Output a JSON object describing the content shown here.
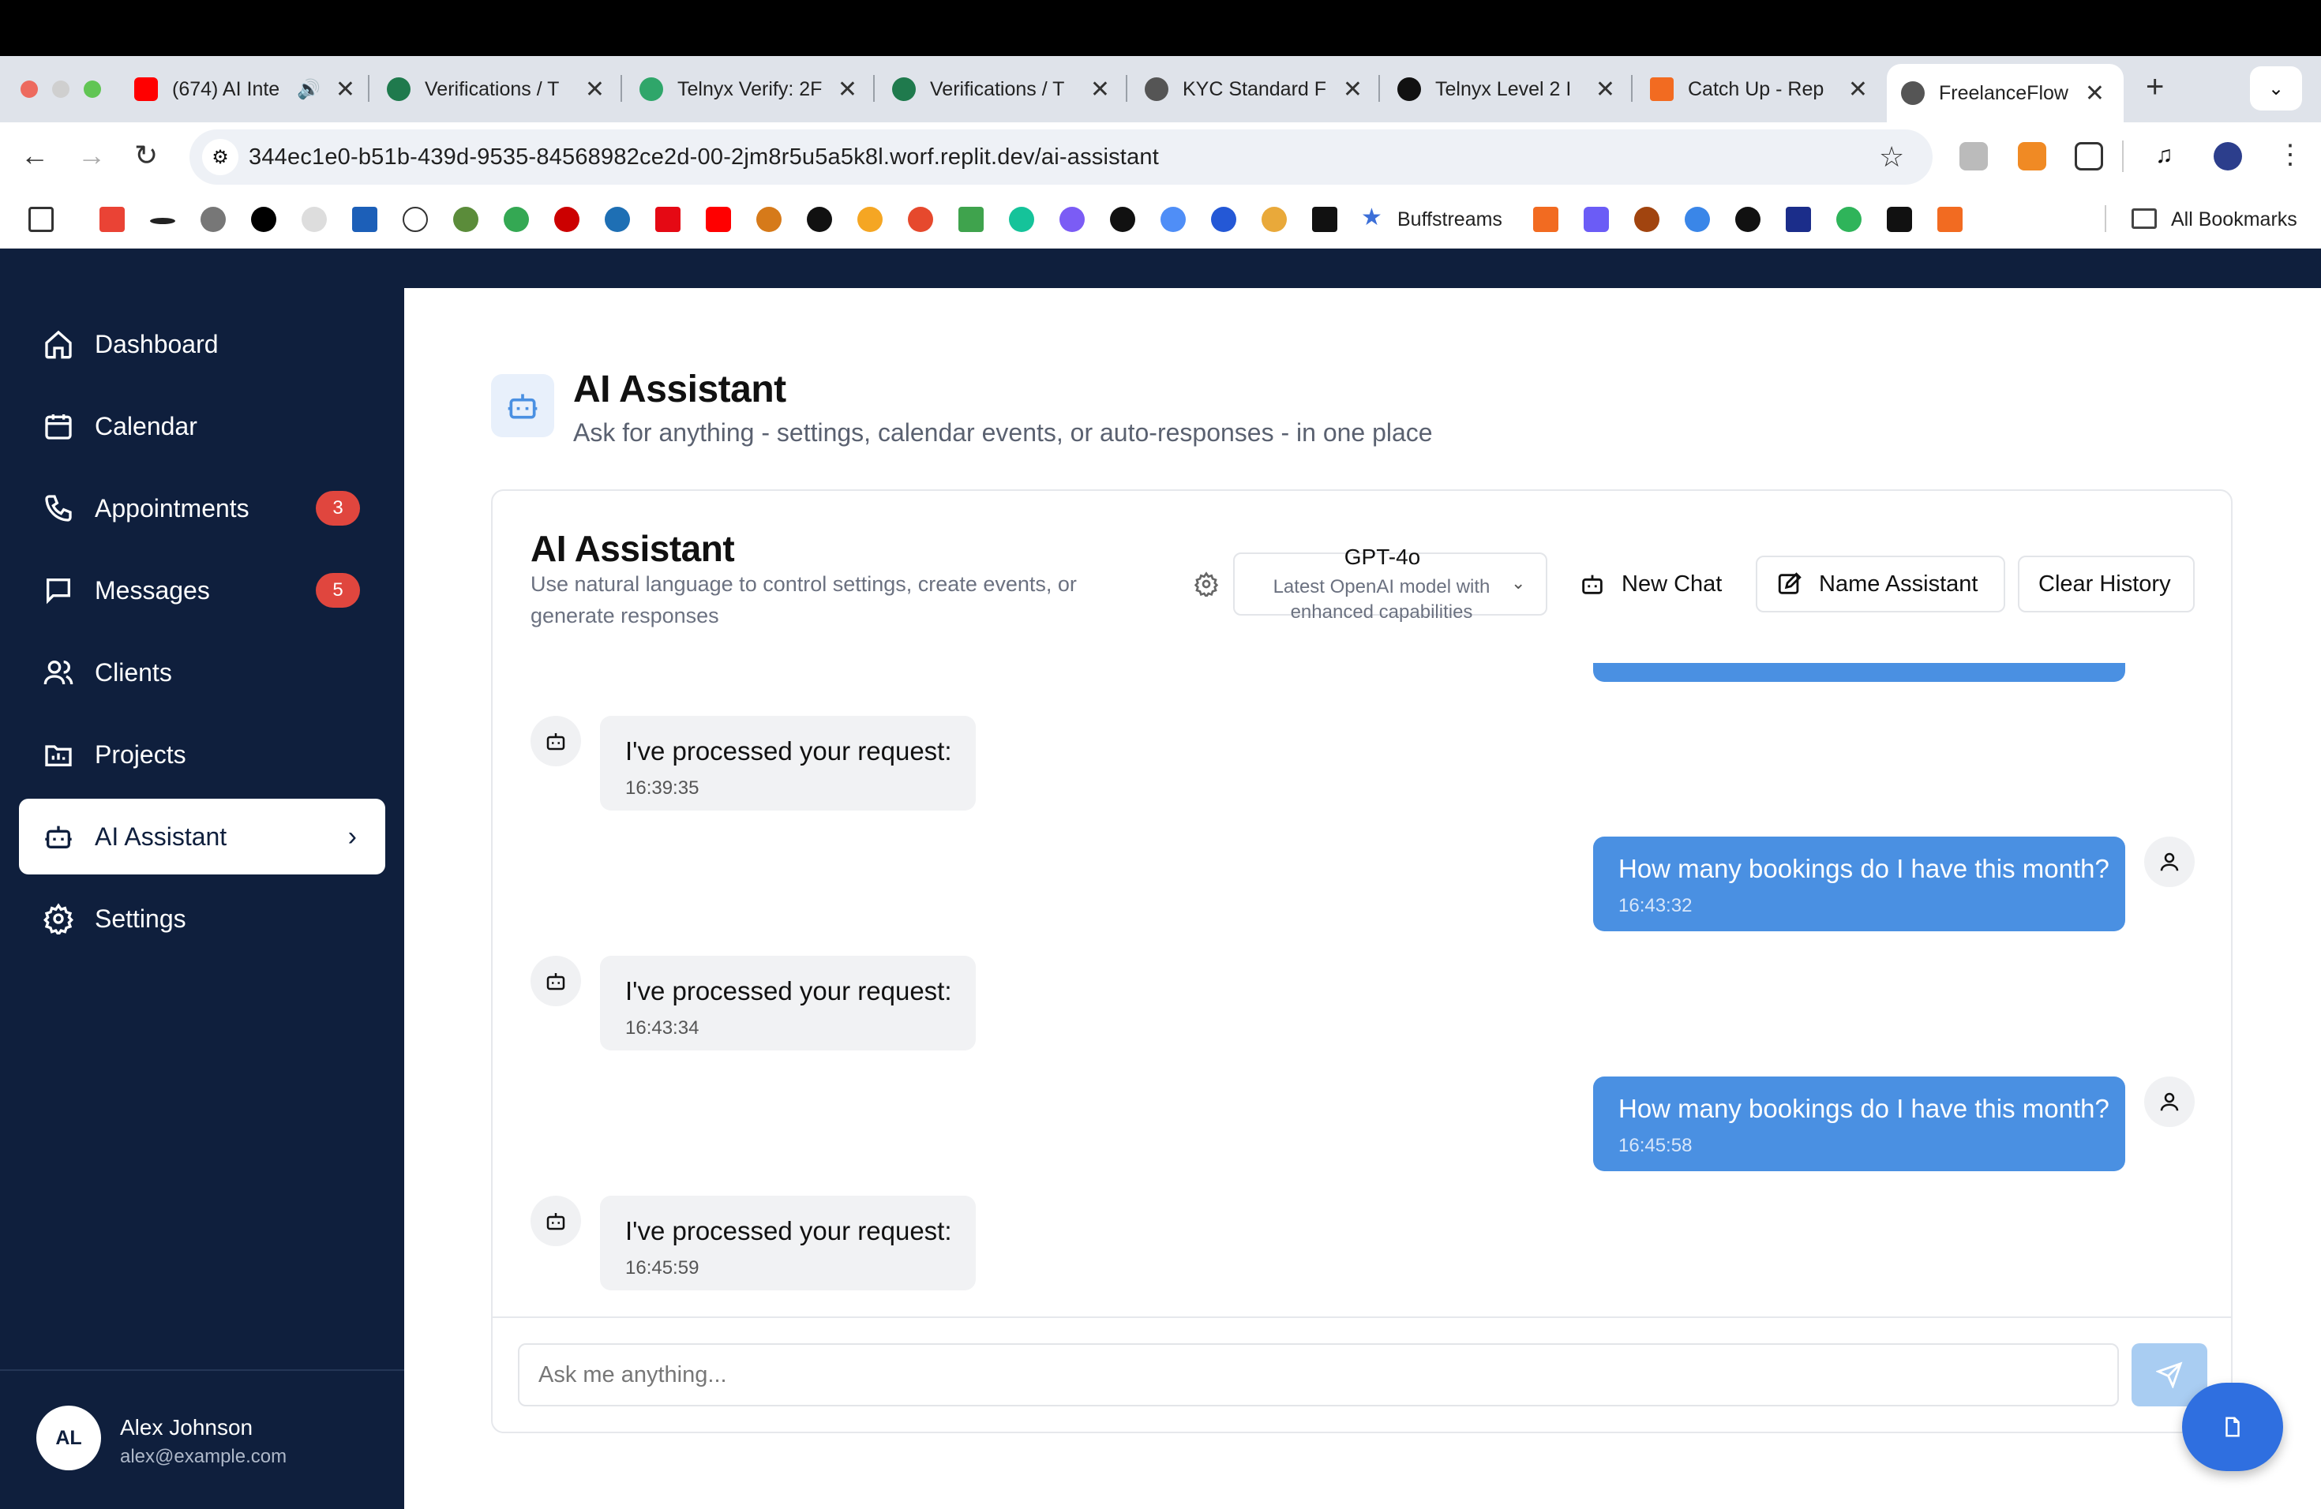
{
  "browser": {
    "tabs": [
      {
        "title": "(674) AI Inte",
        "close": "✕"
      },
      {
        "title": "Verifications / T",
        "close": "✕"
      },
      {
        "title": "Telnyx Verify: 2F",
        "close": "✕"
      },
      {
        "title": "Verifications / T",
        "close": "✕"
      },
      {
        "title": "KYC Standard F",
        "close": "✕"
      },
      {
        "title": "Telnyx Level 2 I",
        "close": "✕"
      },
      {
        "title": "Catch Up - Rep",
        "close": "✕"
      },
      {
        "title": "FreelanceFlow",
        "close": "✕"
      }
    ],
    "new_tab": "+",
    "url": "344ec1e0-b51b-439d-9535-84568982ce2d-00-2jm8r5u5a5k8l.worf.replit.dev/ai-assistant",
    "bookmarks": {
      "buffstreams": "Buffstreams",
      "all_bookmarks": "All Bookmarks"
    }
  },
  "sidebar": {
    "items": [
      {
        "label": "Dashboard",
        "icon": "home-icon"
      },
      {
        "label": "Calendar",
        "icon": "calendar-icon"
      },
      {
        "label": "Appointments",
        "icon": "phone-icon",
        "badge": "3"
      },
      {
        "label": "Messages",
        "icon": "message-icon",
        "badge": "5"
      },
      {
        "label": "Clients",
        "icon": "users-icon"
      },
      {
        "label": "Projects",
        "icon": "projects-icon"
      },
      {
        "label": "AI Assistant",
        "icon": "bot-icon",
        "active": true
      },
      {
        "label": "Settings",
        "icon": "gear-icon"
      }
    ],
    "user": {
      "initials": "AL",
      "name": "Alex Johnson",
      "email": "alex@example.com"
    }
  },
  "page": {
    "title": "AI Assistant",
    "subtitle": "Ask for anything - settings, calendar events, or auto-responses - in one place"
  },
  "card": {
    "title": "AI Assistant",
    "subtitle": "Use natural language to control settings, create events, or generate responses",
    "model": {
      "name": "GPT-4o",
      "description": "Latest OpenAI model with enhanced capabilities"
    },
    "buttons": {
      "new_chat": "New Chat",
      "name_assistant": "Name Assistant",
      "clear_history": "Clear History"
    }
  },
  "messages": [
    {
      "role": "bot",
      "text": "I've processed your request:",
      "time": "16:39:35"
    },
    {
      "role": "user",
      "text": "How many bookings do I have this month?",
      "time": "16:43:32"
    },
    {
      "role": "bot",
      "text": "I've processed your request:",
      "time": "16:43:34"
    },
    {
      "role": "user",
      "text": "How many bookings do I have this month?",
      "time": "16:45:58"
    },
    {
      "role": "bot",
      "text": "I've processed your request:",
      "time": "16:45:59"
    }
  ],
  "input": {
    "placeholder": "Ask me anything..."
  },
  "colors": {
    "sidebar": "#0f1f3d",
    "accent": "#4a90e2",
    "badge": "#e0463e",
    "fab": "#2f6fe0"
  }
}
